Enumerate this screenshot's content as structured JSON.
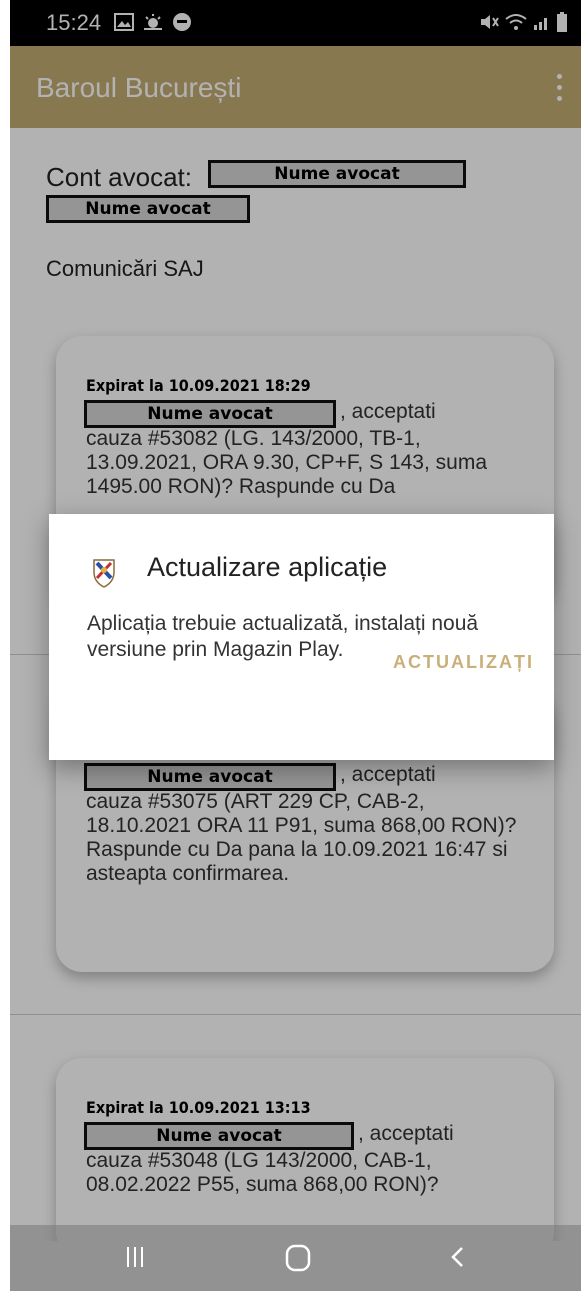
{
  "status_bar": {
    "time": "15:24",
    "icons": [
      "gallery-icon",
      "weather-icon",
      "message-icon",
      "mute-icon",
      "wifi-icon",
      "signal-icon",
      "battery-icon"
    ]
  },
  "app_bar": {
    "title": "Baroul București",
    "menu_icon": "overflow-menu-icon"
  },
  "account": {
    "label": "Cont avocat:",
    "name_redacted_1": "Nume avocat",
    "name_redacted_2": "Nume avocat"
  },
  "section_title": "Comunicări SAJ",
  "cards": [
    {
      "expired": "Expirat la 10.09.2021 18:29",
      "name": "Nume avocat",
      "text_suffix": ", acceptati",
      "body": "cauza #53082 (LG. 143/2000, TB-1, 13.09.2021, ORA 9.30, CP+F, S 143, suma 1495.00 RON)? Raspunde cu Da"
    },
    {
      "name": "Nume avocat",
      "text_suffix": ", acceptati",
      "body": "cauza #53075 (ART 229 CP, CAB-2, 18.10.2021 ORA 11 P91, suma 868,00 RON)? Raspunde cu Da pana la 10.09.2021 16:47 si asteapta confirmarea."
    },
    {
      "expired": "Expirat la 10.09.2021 13:13",
      "name": "Nume avocat",
      "text_suffix": ", acceptati",
      "body": "cauza #53048 (LG 143/2000, CAB-1, 08.02.2022 P55, suma 868,00 RON)?"
    }
  ],
  "dialog": {
    "title": "Actualizare aplicație",
    "message": "Aplicația trebuie actualizată, instalați nouă versiune prin Magazin Play.",
    "button": "ACTUALIZAȚI",
    "accent": "#c9b079"
  },
  "nav_bar": {
    "icons": [
      "recent-apps-icon",
      "home-icon",
      "back-icon"
    ]
  },
  "colors": {
    "app_bar": "#c3ac72",
    "accent": "#c9b079"
  }
}
